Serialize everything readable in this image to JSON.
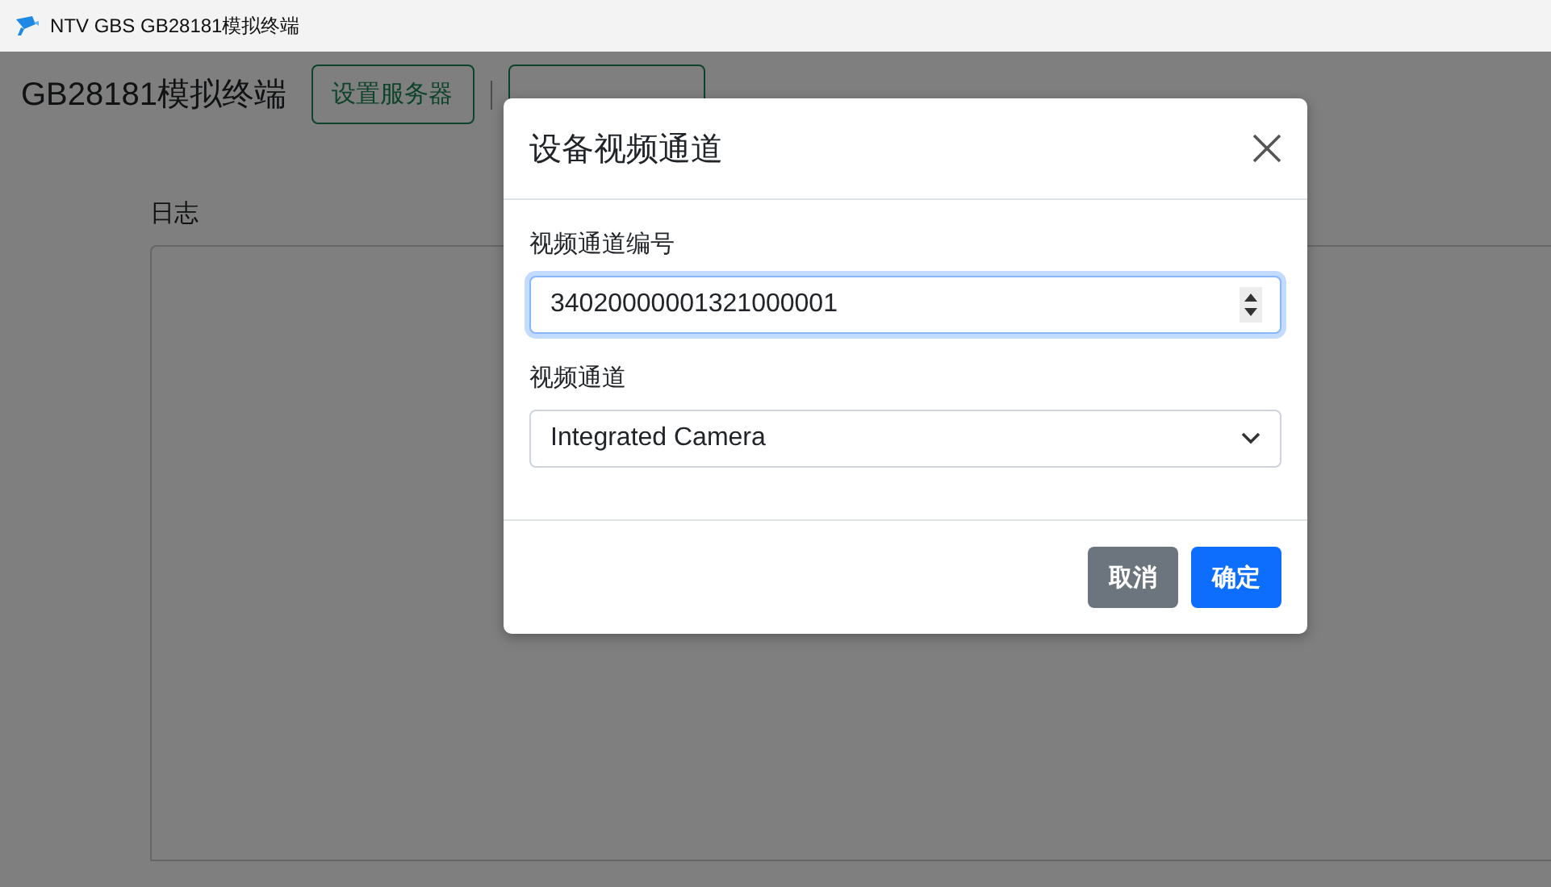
{
  "window": {
    "title": "NTV GBS GB28181模拟终端"
  },
  "header": {
    "title": "GB28181模拟终端",
    "buttons": [
      {
        "kind": "labeled",
        "label": "设置服务器"
      },
      {
        "kind": "blank"
      }
    ]
  },
  "log": {
    "label": "日志"
  },
  "dialog": {
    "title": "设备视频通道",
    "fields": [
      {
        "kind": "number",
        "label": "视频通道编号",
        "value": "34020000001321000001",
        "focused": true
      },
      {
        "kind": "select",
        "label": "视频通道",
        "value": "Integrated Camera",
        "focused": false
      }
    ],
    "buttons": [
      {
        "kind": "secondary",
        "label": "取消"
      },
      {
        "kind": "primary",
        "label": "确定"
      }
    ]
  }
}
